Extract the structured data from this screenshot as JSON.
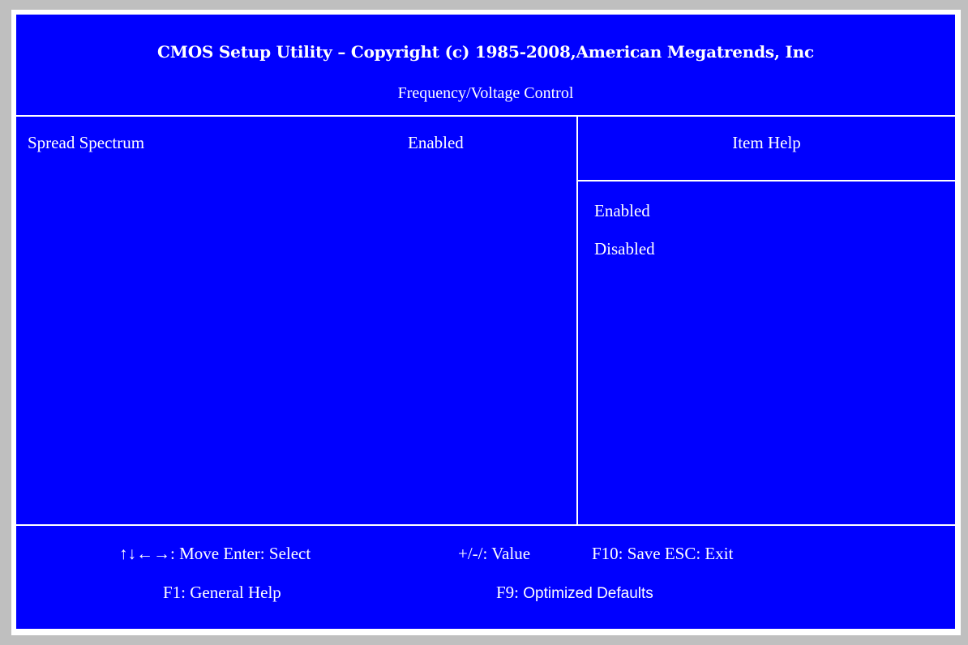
{
  "header": {
    "title": "CMOS Setup Utility – Copyright (c) 1985-2008,American Megatrends, Inc",
    "subtitle": "Frequency/Voltage Control"
  },
  "settings": [
    {
      "label": "Spread Spectrum",
      "value": "Enabled"
    }
  ],
  "help": {
    "title": "Item Help",
    "options": [
      "Enabled",
      "Disabled"
    ]
  },
  "footer": {
    "move": "↑↓←→: Move Enter: Select",
    "value": "+/-/: Value",
    "save_exit": "F10: Save ESC: Exit",
    "general_help": "F1: General Help",
    "f9_key": "F9: ",
    "f9_label": "Optimized Defaults"
  },
  "colors": {
    "background": "#0000ff",
    "text": "#ffffff",
    "border": "#ffffff"
  }
}
